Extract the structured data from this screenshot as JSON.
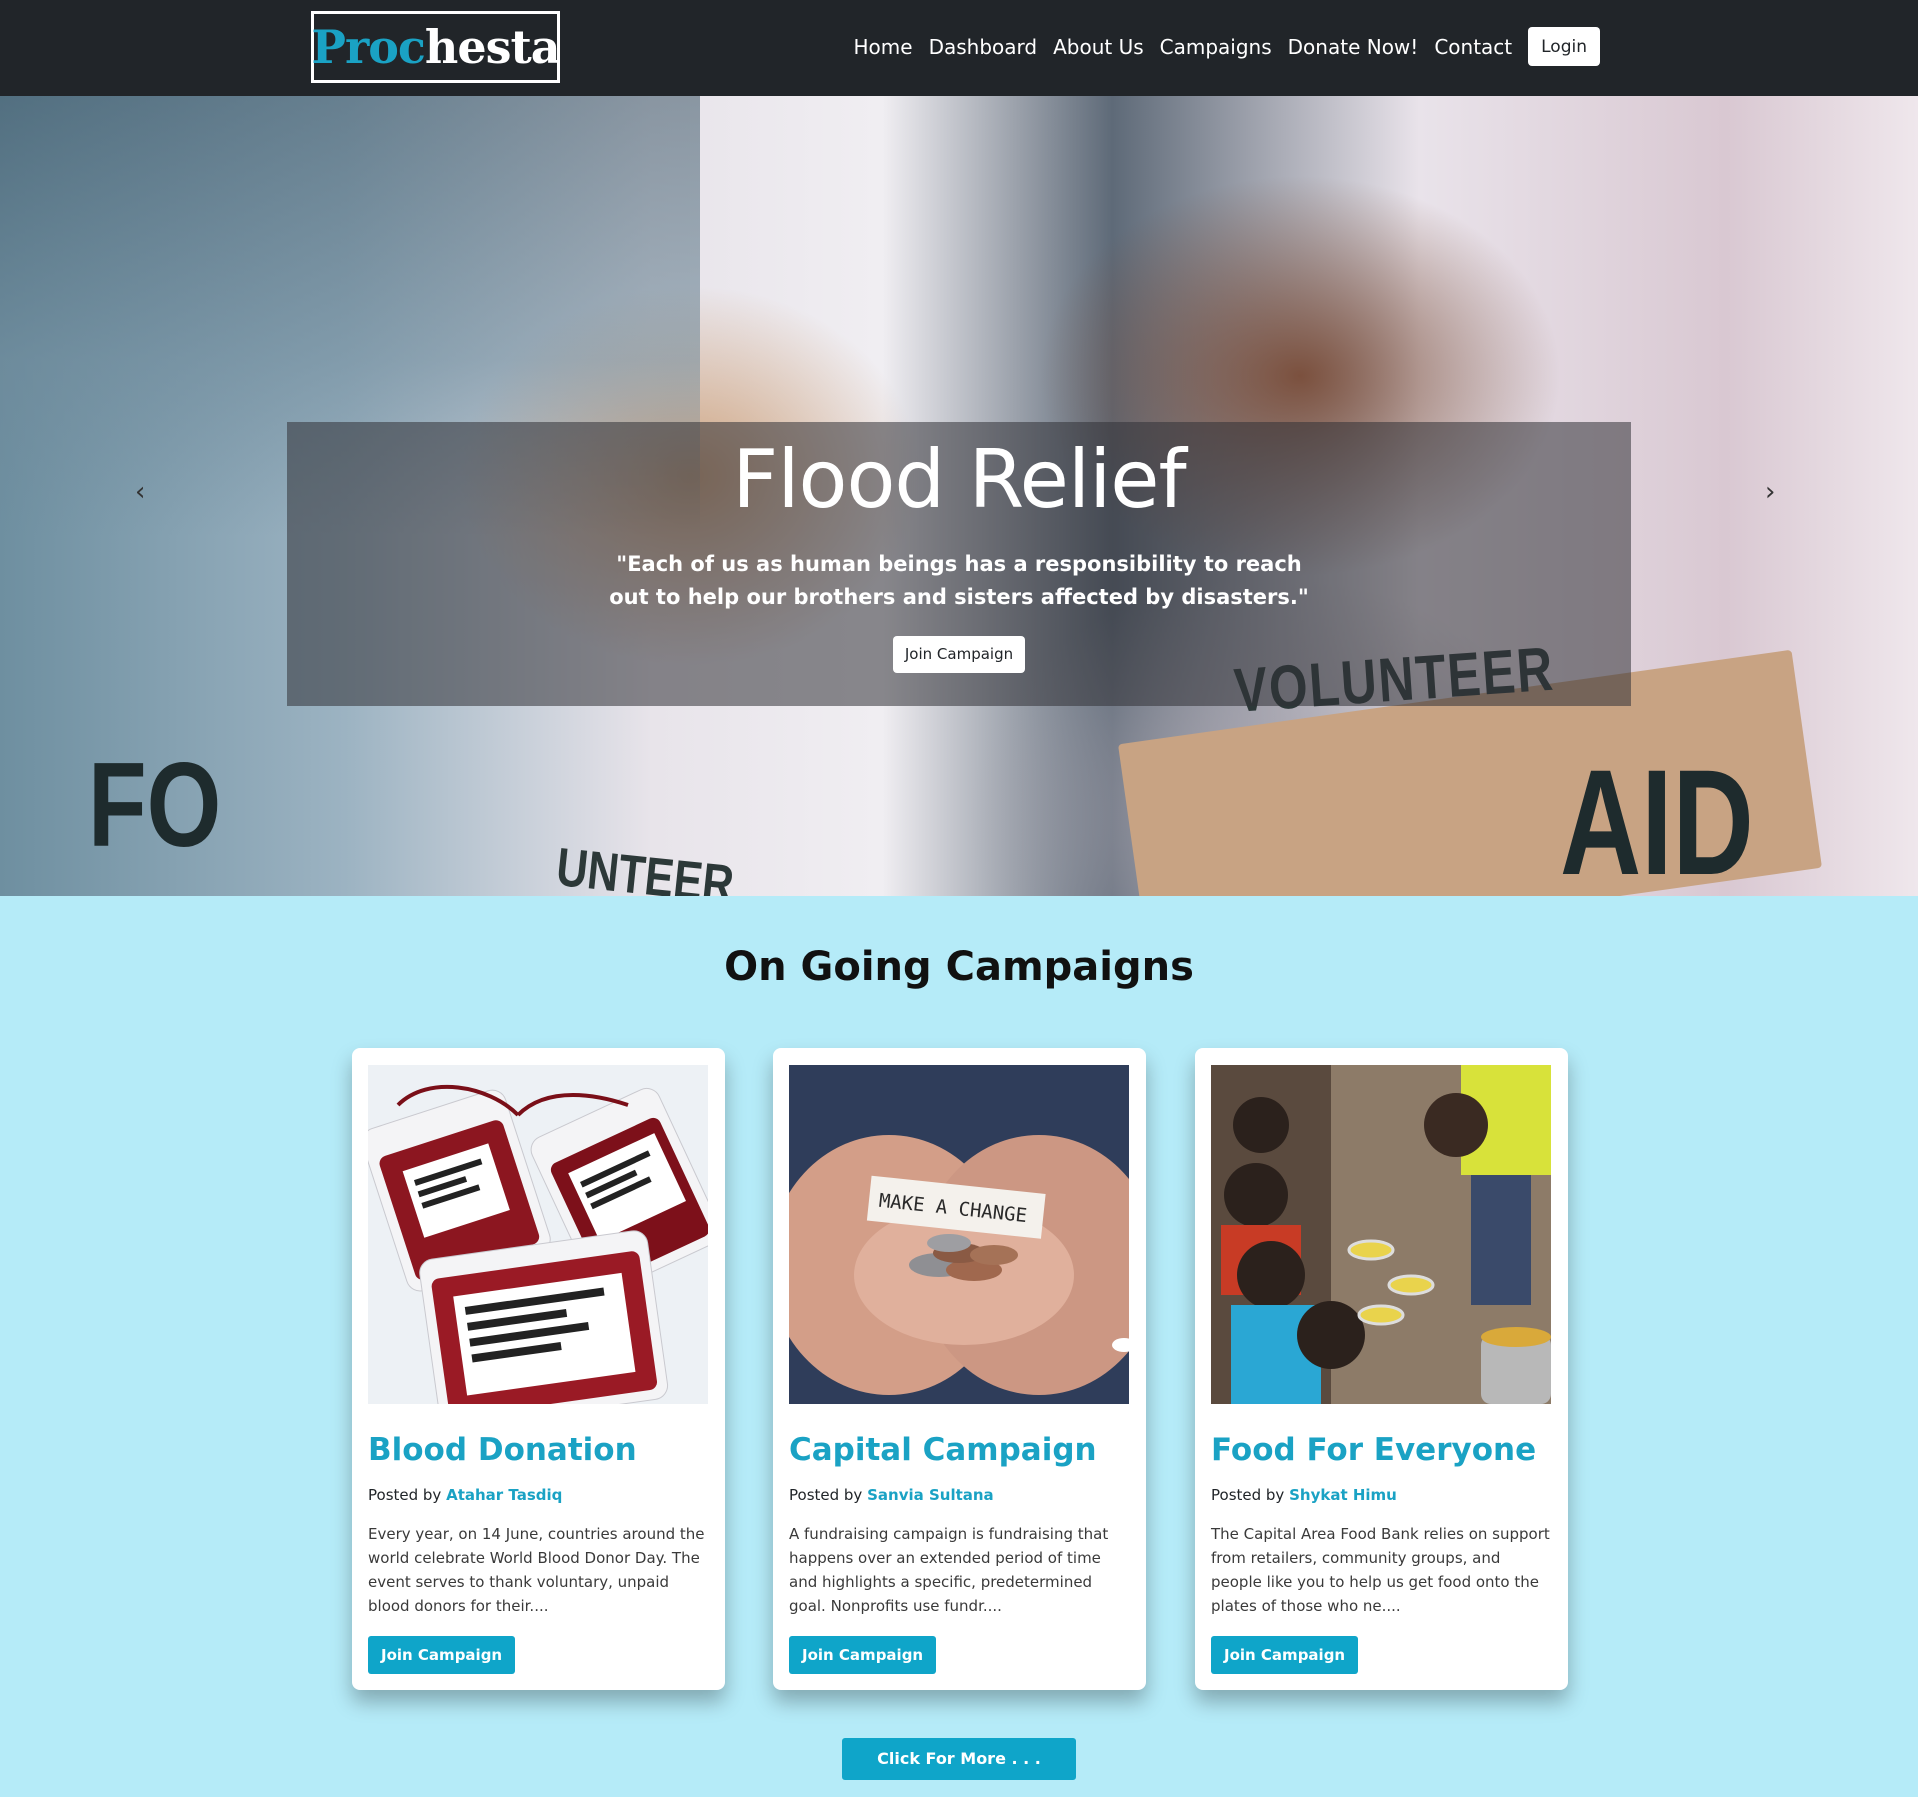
{
  "brand": {
    "part1": "Proc",
    "part2": "hesta"
  },
  "nav": {
    "items": [
      {
        "label": "Home"
      },
      {
        "label": "Dashboard"
      },
      {
        "label": "About Us"
      },
      {
        "label": "Campaigns"
      },
      {
        "label": "Donate Now!"
      },
      {
        "label": "Contact"
      }
    ],
    "login_label": "Login"
  },
  "hero": {
    "title": "Flood Relief",
    "quote": "\"Each of us as human beings has a responsibility to reach out to help our brothers and sisters affected by disasters.\"",
    "button_label": "Join Campaign",
    "image_text": {
      "shirt_left": "FO",
      "shirt_right": "VOLUNTEER",
      "shirt_bottom": "UNTEER",
      "box": "AID"
    },
    "slides_count": 3,
    "active_slide": 2
  },
  "section": {
    "title": "On Going Campaigns"
  },
  "campaigns": [
    {
      "title": "Blood Donation",
      "posted_by_label": "Posted by",
      "author": "Atahar Tasdiq",
      "description": "Every year, on 14 June, countries around the world celebrate World Blood Donor Day. The event serves to thank voluntary, unpaid blood donors for their....",
      "button_label": "Join Campaign",
      "image_icon": "blood-bags-image"
    },
    {
      "title": "Capital Campaign",
      "posted_by_label": "Posted by",
      "author": "Sanvia Sultana",
      "description": "A fundraising campaign is fundraising that happens over an extended period of time and highlights a specific, predetermined goal. Nonprofits use fundr....",
      "button_label": "Join Campaign",
      "image_icon": "hands-coins-image",
      "image_text": "MAKE A CHANGE"
    },
    {
      "title": "Food For Everyone",
      "posted_by_label": "Posted by",
      "author": "Shykat Himu",
      "description": "The Capital Area Food Bank relies on support from retailers, community groups, and people like you to help us get food onto the plates of those who ne....",
      "button_label": "Join Campaign",
      "image_icon": "food-serving-image"
    }
  ],
  "more_button": "Click For More . . .",
  "colors": {
    "accent": "#1aa2c4",
    "button": "#0fa5c9",
    "navbar": "#212529",
    "section_bg": "#b5ebf8"
  }
}
